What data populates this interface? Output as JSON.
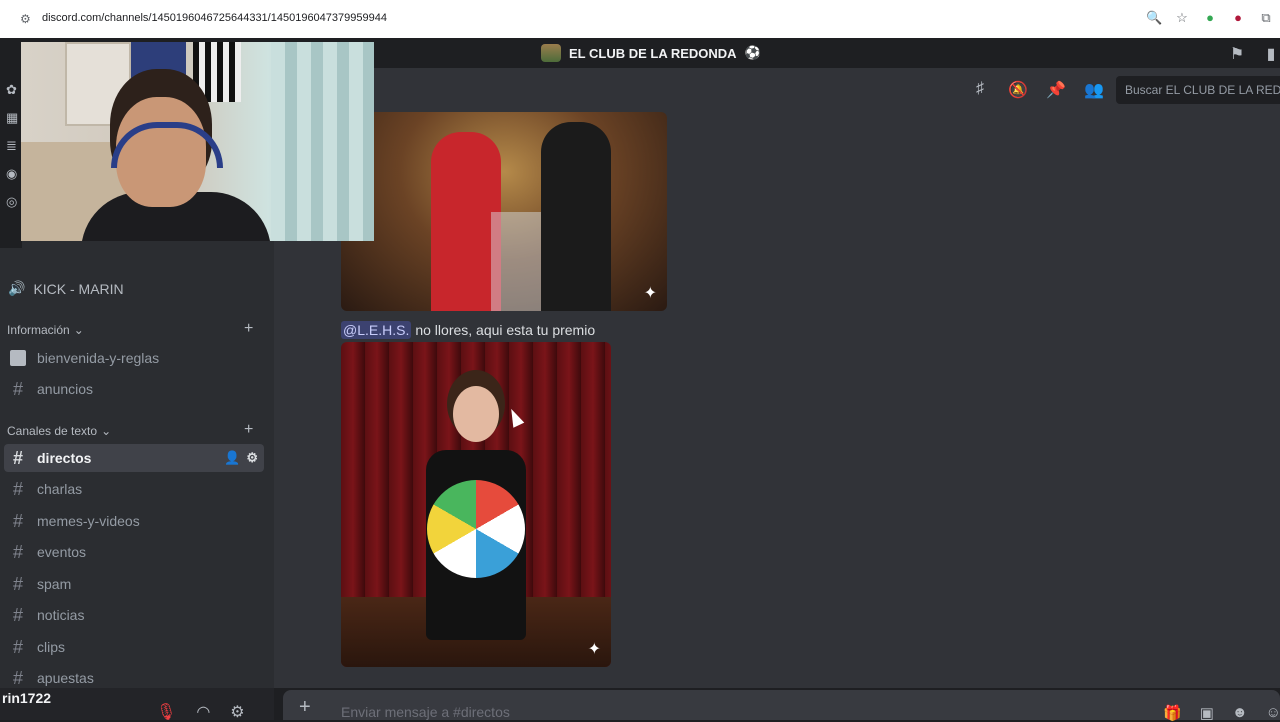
{
  "browser": {
    "url": "discord.com/channels/1450196046725644331/1450196047379959944",
    "icons": [
      "zoom-icon",
      "star-icon",
      "extension-icon",
      "extension-icon",
      "puzzle-icon"
    ]
  },
  "server": {
    "name": "EL CLUB DE LA REDONDA",
    "badge": "⚽"
  },
  "sidebar": {
    "voice_channel": "KICK - MARIN",
    "categories": [
      {
        "name": "Información",
        "channels": [
          {
            "name": "bienvenida-y-reglas",
            "type": "rules"
          },
          {
            "name": "anuncios",
            "type": "text"
          }
        ]
      },
      {
        "name": "Canales de texto",
        "channels": [
          {
            "name": "directos",
            "type": "text",
            "active": true
          },
          {
            "name": "charlas",
            "type": "text"
          },
          {
            "name": "memes-y-videos",
            "type": "text"
          },
          {
            "name": "eventos",
            "type": "text"
          },
          {
            "name": "spam",
            "type": "text"
          },
          {
            "name": "noticias",
            "type": "text"
          },
          {
            "name": "clips",
            "type": "text"
          },
          {
            "name": "apuestas",
            "type": "text"
          }
        ]
      }
    ]
  },
  "user_panel": {
    "username": "rin1722"
  },
  "chat": {
    "search_placeholder": "Buscar EL CLUB DE LA REDONDA",
    "message": {
      "mention": "@L.E.H.S.",
      "text": "no llores, aqui esta tu premio"
    },
    "composer_placeholder": "Enviar mensaje a #directos"
  },
  "colors": {
    "accent": "#5865f2",
    "mention_bg": "#3c4270",
    "muted_red": "#f23f42"
  }
}
